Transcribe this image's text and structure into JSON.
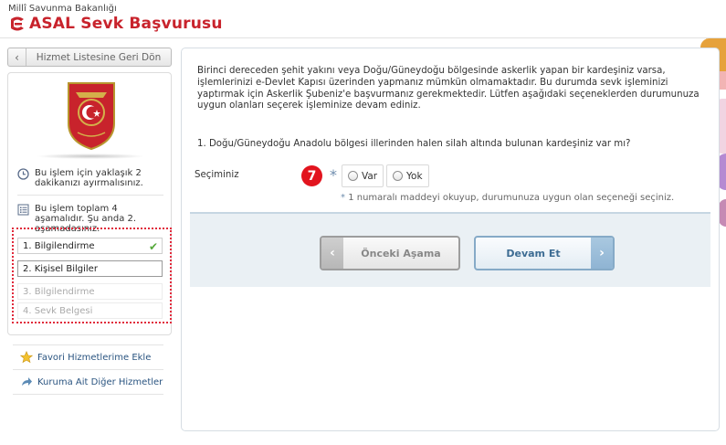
{
  "header": {
    "ministry": "Millî Savunma Bakanlığı",
    "title": "ASAL Sevk Başvurusu",
    "brand_color": "#c8232c"
  },
  "sidebar": {
    "back_label": "Hizmet Listesine Geri Dön",
    "duration_text": "Bu işlem için yaklaşık 2 dakikanızı ayırmalısınız.",
    "stages_text": "Bu işlem toplam 4 aşamalıdır. Şu anda 2. aşamadasınız.",
    "steps": [
      {
        "label": "1. Bilgilendirme",
        "state": "done"
      },
      {
        "label": "2. Kişisel Bilgiler",
        "state": "active"
      },
      {
        "label": "3. Bilgilendirme",
        "state": "disabled"
      },
      {
        "label": "4. Sevk Belgesi",
        "state": "disabled"
      }
    ],
    "links": [
      {
        "label": "Favori Hizmetlerime Ekle",
        "icon": "star-icon"
      },
      {
        "label": "Kuruma Ait Diğer Hizmetler",
        "icon": "share-arrow-icon"
      }
    ]
  },
  "main": {
    "intro": "Birinci dereceden şehit yakını veya Doğu/Güneydoğu bölgesinde askerlik yapan bir kardeşiniz varsa, işlemlerinizi e-Devlet Kapısı üzerinden yapmanız mümkün olmamaktadır. Bu durumda sevk işleminizi yaptırmak için Askerlik Şubeniz'e başvurmanız gerekmektedir. Lütfen aşağıdaki seçeneklerden durumunuza uygun olanları seçerek işleminize devam ediniz.",
    "question": "1. Doğu/Güneydoğu Anadolu bölgesi illerinden halen silah altında bulunan kardeşiniz var mı?",
    "selection_label": "Seçiminiz",
    "badge": "7",
    "required_mark": "*",
    "options": [
      "Var",
      "Yok"
    ],
    "hint_star": "*",
    "hint": "1 numaralı maddeyi okuyup, durumunuza uygun olan seçeneği seçiniz.",
    "prev_label": "Önceki Aşama",
    "next_label": "Devam Et"
  }
}
